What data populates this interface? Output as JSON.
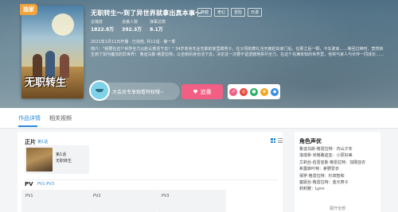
{
  "hero": {
    "badge": "独家",
    "title": "无职转生～到了异世界就拿出真本事～",
    "tags": [
      "穿越",
      "奇幻",
      "冒险",
      "日漫"
    ],
    "stats": [
      {
        "label": "总播放",
        "value": "1822.8万"
      },
      {
        "label": "追番人数",
        "value": "392.3万"
      },
      {
        "label": "弹幕总数",
        "value": "8.1万"
      }
    ],
    "meta": "2021年1月11日开播 · 已完结, 共11话 · 第一季",
    "description": "简介：\"我要在这个世界全力以赴认真活下去！\" 34岁单身无业无职的家里蹲男子，在父母的葬礼当天被赶出家门后，在那之后一瞬，卡车驶来……等回过神时，竟然转生到了剑与魔法的异世界！ 鲁迪乌斯·格雷拉特，以全新的身份活下去，决定这一次要不留遗憾地拼尽全力。在这个充满未知的世界里，他将与家人与伙伴一同成长……",
    "vip_text": "大会员专享观看特权哦~",
    "follow_label": "追番",
    "poster_title": "无职转生"
  },
  "tabs": [
    {
      "label": "作品详情",
      "active": true
    },
    {
      "label": "相关视频",
      "active": false
    }
  ],
  "main": {
    "episodes_title": "正片",
    "episodes_link": "第1话",
    "episode_card": {
      "number": "第1话",
      "name": "无职转生"
    },
    "pv_title": "PV",
    "pv_link": "PV1-PV3",
    "pv_items": [
      "PV1",
      "PV2",
      "PV3"
    ]
  },
  "side": {
    "title": "角色声优",
    "cast": [
      "鲁迪乌斯·格雷拉特：内山夕实",
      "洛琪希·米格路迪亚：小原好美",
      "艾莉丝·伯雷亚斯·格雷拉特：加隈亚衣",
      "希露菲叶特：茅野爱衣",
      "保罗·格雷拉特：杉田智和",
      "塞妮丝·格雷拉特：金元寿子",
      "莉莉雅：Lynn"
    ],
    "more": "展开全部"
  },
  "colors": {
    "accent": "#2a8ad8",
    "follow": "#f25f84",
    "badge": "#f2a23a"
  }
}
